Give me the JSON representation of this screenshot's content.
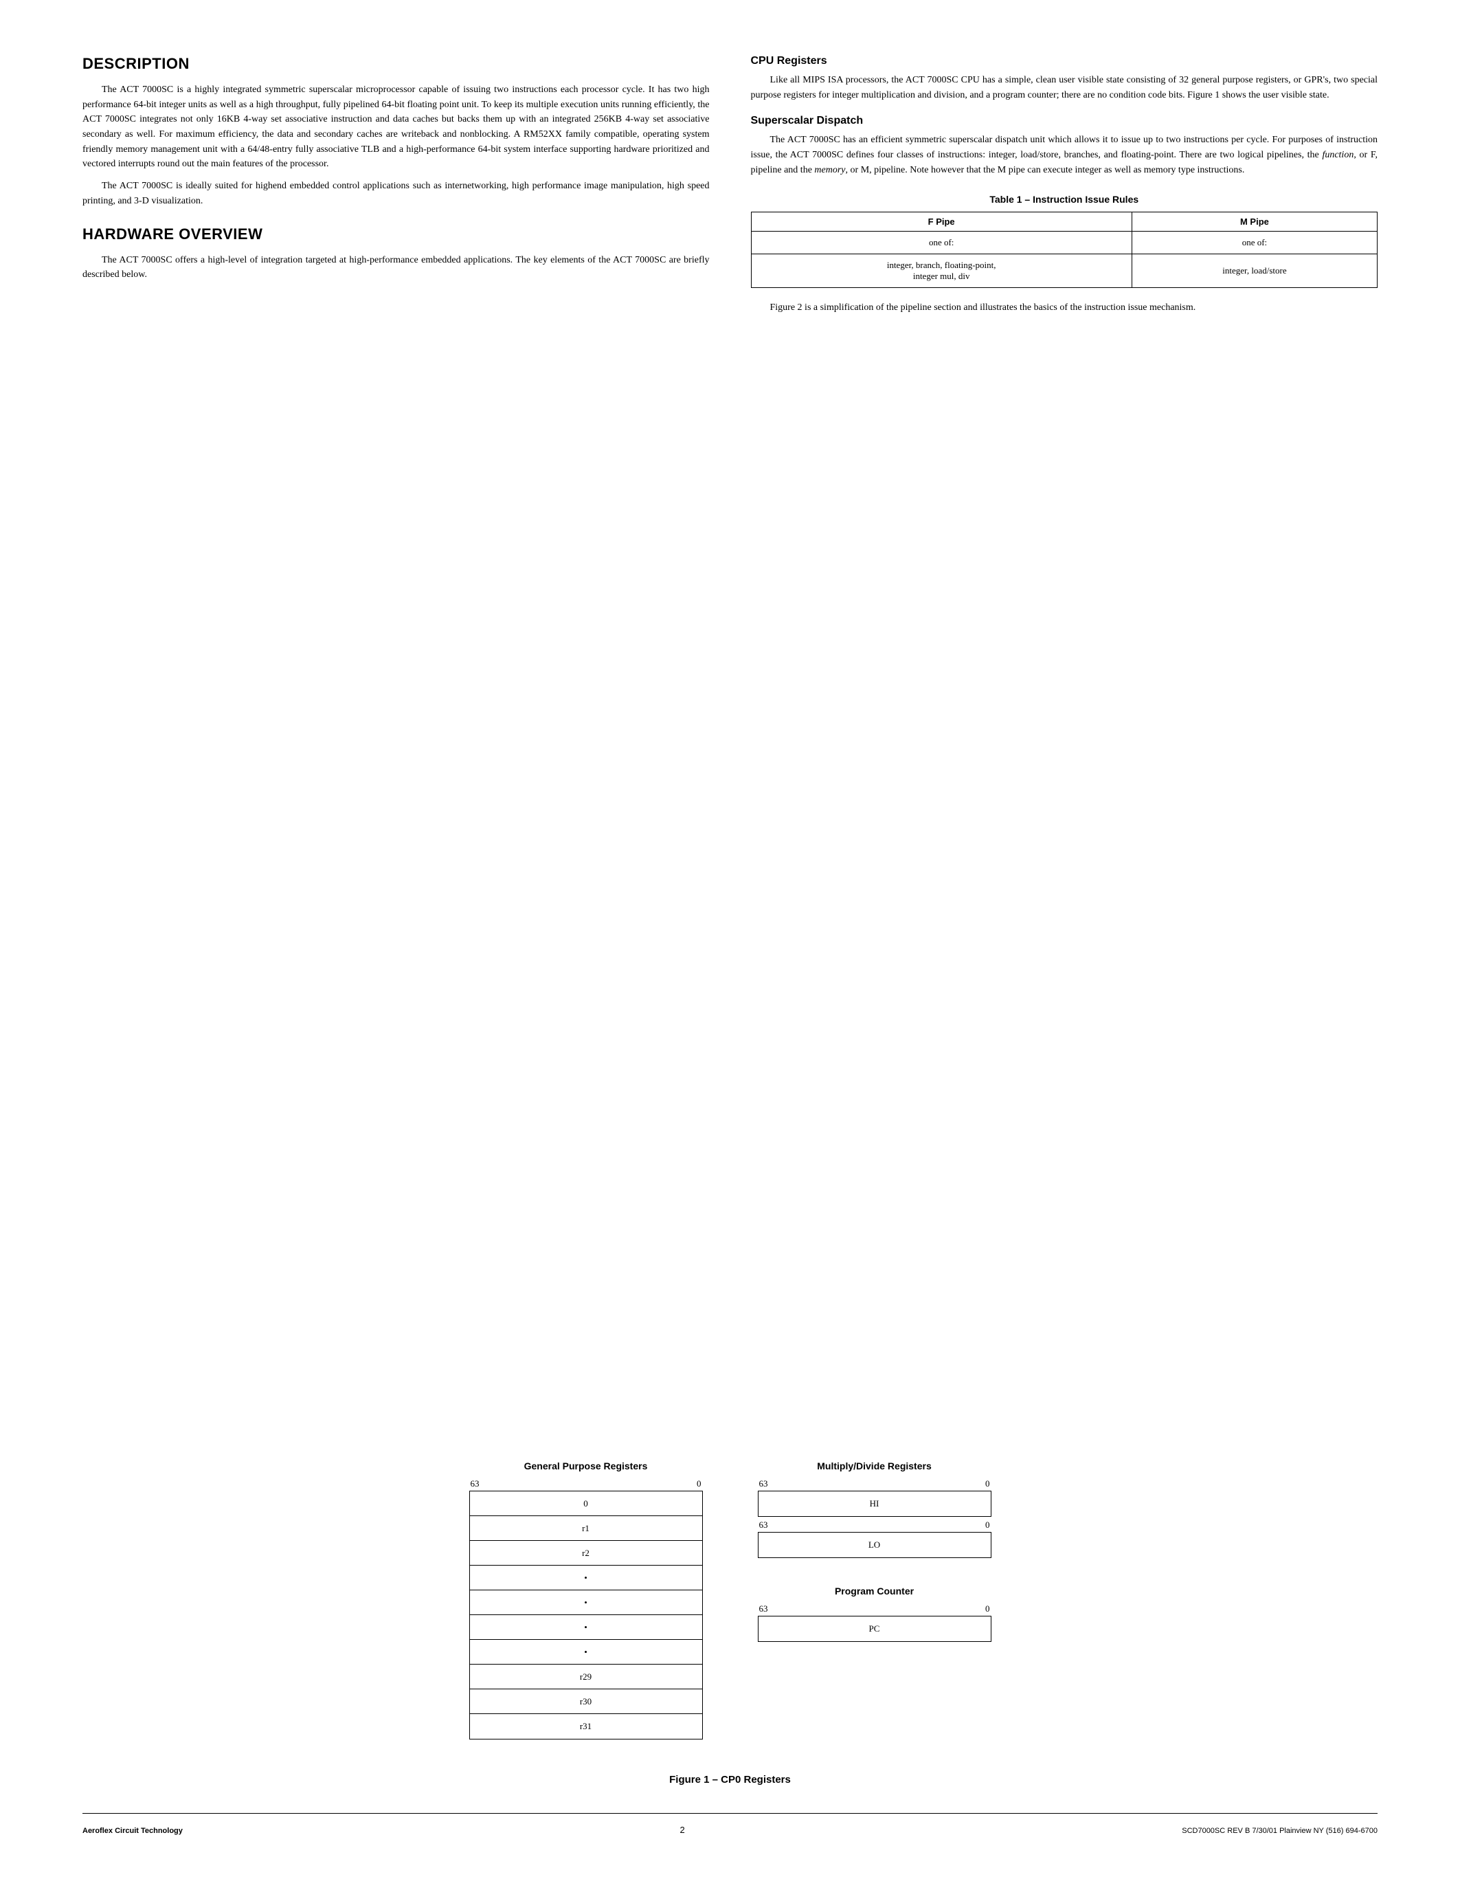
{
  "page": {
    "sections": {
      "description": {
        "title": "DESCRIPTION",
        "paragraphs": [
          "The ACT 7000SC is a highly integrated symmetric superscalar microprocessor capable of issuing two instructions each processor cycle. It has two high performance 64-bit integer units as well as a high throughput, fully pipelined 64-bit floating point unit. To keep its multiple execution units running efficiently, the ACT 7000SC integrates not only 16KB 4-way set associative instruction and data caches but backs them up with an integrated 256KB 4-way set associative secondary as well. For maximum efficiency, the data and secondary caches are writeback and nonblocking. A RM52XX family compatible, operating system friendly memory management unit with a 64/48-entry fully associative TLB and a high-performance 64-bit system interface supporting hardware prioritized and vectored interrupts round out the main features of the processor.",
          "The ACT 7000SC is ideally suited for highend embedded control applications such as internetworking, high performance image manipulation, high speed printing, and 3-D visualization."
        ]
      },
      "hardware_overview": {
        "title": "HARDWARE OVERVIEW",
        "paragraphs": [
          "The ACT 7000SC offers a high-level of integration targeted at high-performance embedded applications. The key elements of the ACT 7000SC are briefly described below."
        ]
      },
      "cpu_registers": {
        "title": "CPU Registers",
        "paragraphs": [
          "Like all MIPS ISA processors, the ACT 7000SC CPU has a simple, clean user visible state consisting of 32 general purpose registers, or GPR's, two special purpose registers for integer multiplication and division, and a program counter; there are no condition code bits. Figure 1 shows the user visible state."
        ]
      },
      "superscalar_dispatch": {
        "title": "Superscalar Dispatch",
        "paragraphs": [
          "The ACT 7000SC has an efficient symmetric superscalar dispatch unit which allows it to issue up to two instructions per cycle. For purposes of instruction issue, the ACT 7000SC defines four classes of instructions: integer, load/store, branches, and floating-point. There are two logical pipelines, the function, or F, pipeline and the memory, or M, pipeline. Note however that the M pipe can execute integer as well as memory type instructions."
        ]
      },
      "table1": {
        "title": "Table 1 – Instruction Issue Rules",
        "headers": [
          "F Pipe",
          "M Pipe"
        ],
        "row1": [
          "one of:",
          "one of:"
        ],
        "row2": [
          "integer, branch, floating-point,\ninteger mul, div",
          "integer, load/store"
        ]
      },
      "figure1_caption": "Figure 1 – CP0 Registers",
      "figure_note": "Figure 2 is a simplification of the pipeline section and illustrates the basics of the instruction issue mechanism."
    },
    "diagrams": {
      "gpr": {
        "title": "General Purpose Registers",
        "bit_high": "63",
        "bit_low": "0",
        "rows": [
          "0",
          "r1",
          "r2",
          "•",
          "•",
          "•",
          "•",
          "r29",
          "r30",
          "r31"
        ]
      },
      "multiply_divide": {
        "title": "Multiply/Divide Registers",
        "hi": {
          "bit_high": "63",
          "bit_low": "0",
          "label": "HI"
        },
        "lo": {
          "bit_high": "63",
          "bit_low": "0",
          "label": "LO"
        }
      },
      "program_counter": {
        "title": "Program Counter",
        "bit_high": "63",
        "bit_low": "0",
        "label": "PC"
      }
    },
    "footer": {
      "left": "Aeroflex Circuit Technology",
      "center": "2",
      "right": "SCD7000SC REV B  7/30/01 Plainview NY (516) 694-6700"
    }
  }
}
